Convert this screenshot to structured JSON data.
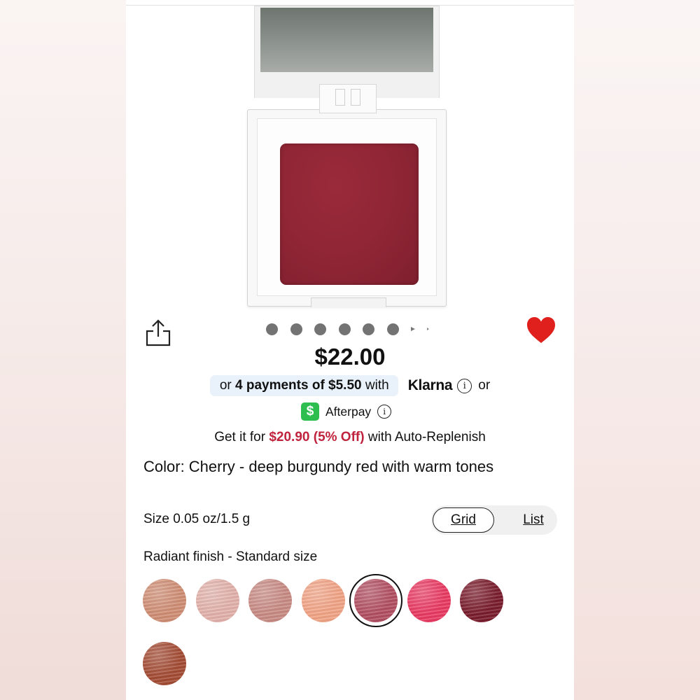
{
  "product": {
    "price": "$22.00",
    "image_carousel": {
      "dot_count": 6,
      "active_index": 0
    },
    "favorited": true
  },
  "payments": {
    "prefix": "or",
    "installments_label": "4 payments of $5.50",
    "with_label": "with",
    "klarna_label": "Klarna",
    "or_label": "or",
    "afterpay_label": "Afterpay",
    "afterpay_icon_glyph": "$",
    "info_icon_glyph": "i"
  },
  "replenish": {
    "prefix": "Get it for",
    "deal": "$20.90 (5% Off)",
    "suffix": "with Auto-Replenish"
  },
  "details": {
    "color_text": "Color: Cherry - deep burgundy red with warm tones",
    "size_text": "Size 0.05 oz/1.5 g",
    "finish_text": "Radiant finish - Standard size"
  },
  "view_toggle": {
    "grid_label": "Grid",
    "list_label": "List",
    "selected": "Grid"
  },
  "swatches": {
    "selected_index": 4,
    "colors": [
      "#d08e74",
      "#e3b2ab",
      "#c98b84",
      "#f2a486",
      "#b24f62",
      "#ea3a62",
      "#7a1c2c",
      "#a44c34"
    ]
  },
  "colors": {
    "deal_red": "#c0233d",
    "heart_red": "#e0201c",
    "klarna_pill_bg": "#e9f2fb",
    "afterpay_green": "#2ebd4f",
    "pan_burgundy": "#8e2535"
  },
  "icons": {
    "share": "share-icon",
    "favorite": "heart-icon",
    "info": "info-icon",
    "afterpay": "afterpay-cash-icon"
  }
}
